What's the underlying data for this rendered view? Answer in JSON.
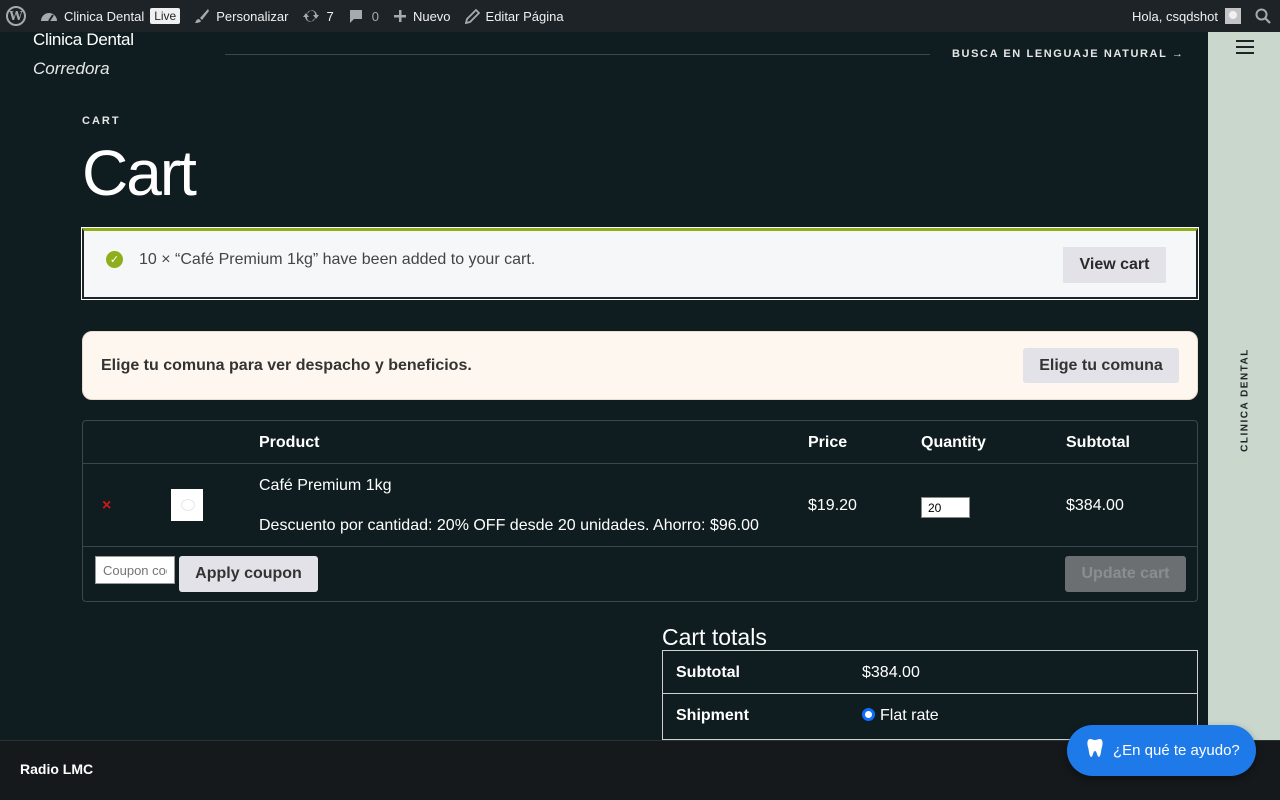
{
  "adminbar": {
    "site_name": "Clinica Dental",
    "live_badge": "Live",
    "customize": "Personalizar",
    "updates_count": "7",
    "comments_count": "0",
    "new": "Nuevo",
    "edit_page": "Editar Página",
    "greeting": "Hola, csqdshot"
  },
  "header": {
    "title": "Clinica Dental",
    "subtitle": "Corredora",
    "nl_search": "BUSCA EN LENGUAJE NATURAL →"
  },
  "sidebar": {
    "label": "CLINICA DENTAL"
  },
  "page": {
    "breadcrumb": "CART",
    "title": "Cart"
  },
  "notice": {
    "message": "10 × “Café Premium 1kg” have been added to your cart.",
    "view_cart": "View cart"
  },
  "comuna": {
    "message": "Elige tu comuna para ver despacho y beneficios.",
    "button": "Elige tu comuna"
  },
  "cart": {
    "headers": {
      "product": "Product",
      "price": "Price",
      "quantity": "Quantity",
      "subtotal": "Subtotal"
    },
    "items": [
      {
        "remove": "×",
        "name": "Café Premium 1kg",
        "description": "Descuento por cantidad: 20% OFF desde 20 unidades. Ahorro: $96.00",
        "price": "$19.20",
        "quantity": "20",
        "subtotal": "$384.00"
      }
    ],
    "coupon_placeholder": "Coupon code",
    "apply_coupon": "Apply coupon",
    "update_cart": "Update cart"
  },
  "totals": {
    "title": "Cart totals",
    "subtotal_label": "Subtotal",
    "subtotal_value": "$384.00",
    "shipment_label": "Shipment",
    "shipment_option": "Flat rate"
  },
  "footer": {
    "radio_label": "Radio LMC"
  },
  "chat": {
    "label": "¿En qué te ayudo?"
  }
}
